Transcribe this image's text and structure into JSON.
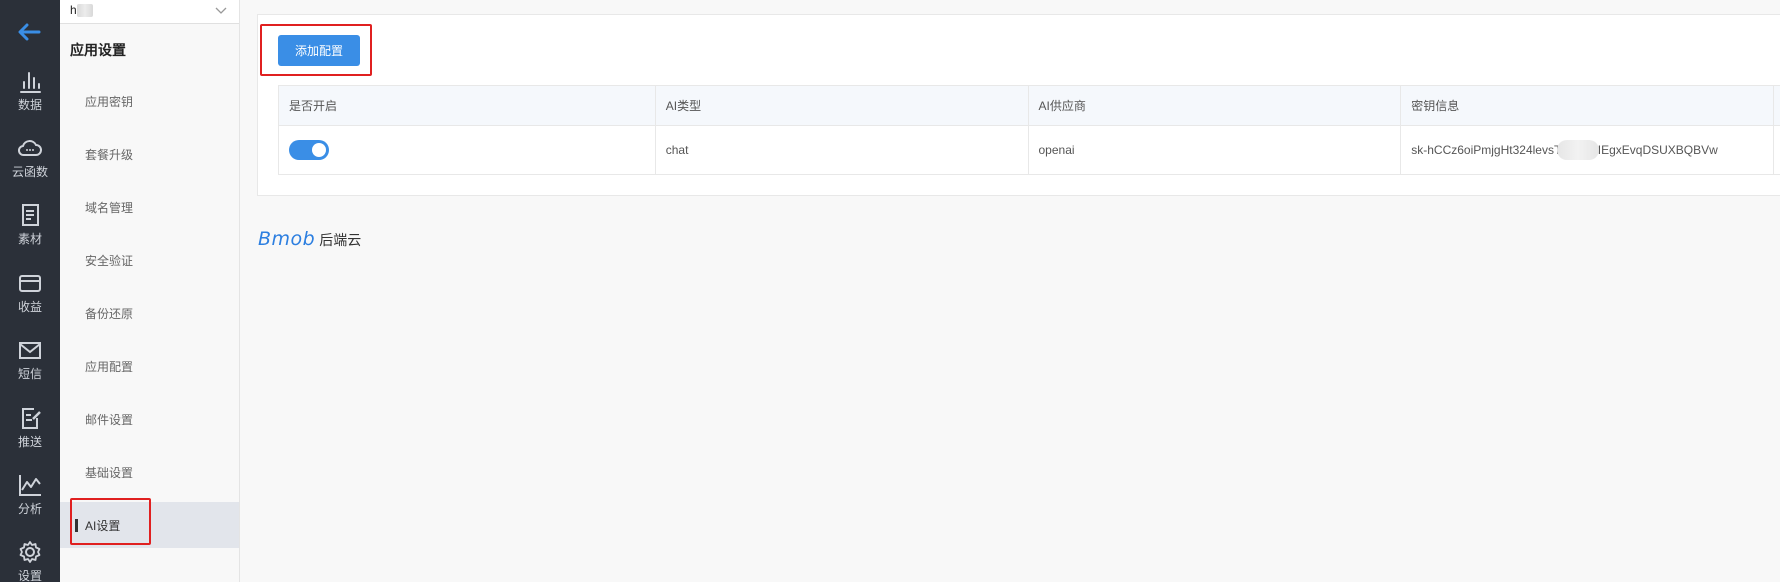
{
  "rail": {
    "back_icon": "arrow-left-icon",
    "items": [
      {
        "label": "数据",
        "icon": "bar-chart-icon"
      },
      {
        "label": "云函数",
        "icon": "cloud-icon"
      },
      {
        "label": "素材",
        "icon": "document-icon"
      },
      {
        "label": "收益",
        "icon": "card-icon"
      },
      {
        "label": "短信",
        "icon": "mail-icon"
      },
      {
        "label": "推送",
        "icon": "edit-doc-icon"
      },
      {
        "label": "分析",
        "icon": "line-chart-icon"
      },
      {
        "label": "设置",
        "icon": "gear-icon"
      }
    ]
  },
  "sidebar": {
    "app_select_value": "h",
    "title": "应用设置",
    "items": [
      {
        "label": "应用密钥"
      },
      {
        "label": "套餐升级"
      },
      {
        "label": "域名管理"
      },
      {
        "label": "安全验证"
      },
      {
        "label": "备份还原"
      },
      {
        "label": "应用配置"
      },
      {
        "label": "邮件设置"
      },
      {
        "label": "基础设置"
      },
      {
        "label": "AI设置",
        "active": true
      }
    ]
  },
  "main": {
    "add_button_label": "添加配置",
    "table": {
      "headers": [
        "是否开启",
        "AI类型",
        "AI供应商",
        "密钥信息"
      ],
      "rows": [
        {
          "enabled": true,
          "type": "chat",
          "provider": "openai",
          "key": "sk-hCCz6oiPmjgHt324levsT           !NdhSIEgxEvqDSUXBQBVw"
        }
      ]
    }
  },
  "footer": {
    "brand_logo": "Bmob",
    "brand_sub": "后端云"
  },
  "colors": {
    "rail_bg": "#2b3039",
    "accent": "#3a8ee6",
    "highlight_box": "#e02020",
    "brand": "#2d7fe0"
  }
}
